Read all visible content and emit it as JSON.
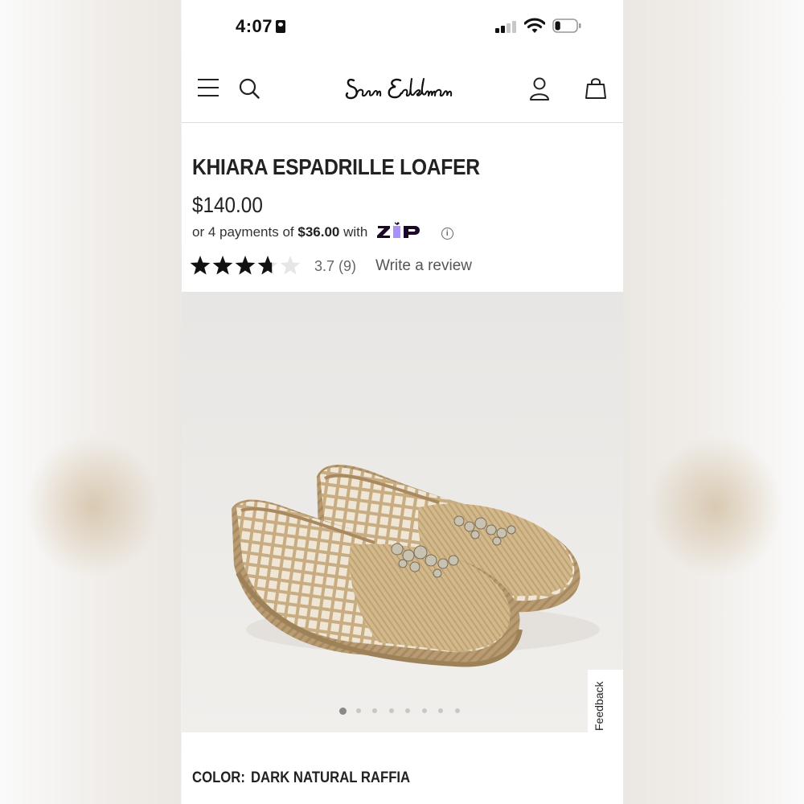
{
  "status_bar": {
    "time": "4:07",
    "battery_level": 0.25
  },
  "header": {
    "brand_logo_text": "Sam Edelman",
    "icons": [
      "menu-icon",
      "search-icon",
      "account-icon",
      "shopping-bag-icon"
    ]
  },
  "product": {
    "title": "KHIARA ESPADRILLE LOAFER",
    "price": "$140.00",
    "installment": {
      "prefix": "or 4 payments of",
      "amount": "$36.00",
      "suffix": "with",
      "provider": "Zip"
    },
    "rating": {
      "value": 3.7,
      "max": 5,
      "summary": "3.7 (9)",
      "write_review_label": "Write a review"
    },
    "image_carousel": {
      "total": 8,
      "active_index": 0
    },
    "color": {
      "label": "COLOR:",
      "value": "DARK NATURAL RAFFIA"
    }
  },
  "feedback_tab_label": "Feedback",
  "colors": {
    "zip_purple": "#1a0826",
    "zip_accent": "#aa8fff",
    "text_primary": "#222222",
    "text_secondary": "#666666"
  }
}
